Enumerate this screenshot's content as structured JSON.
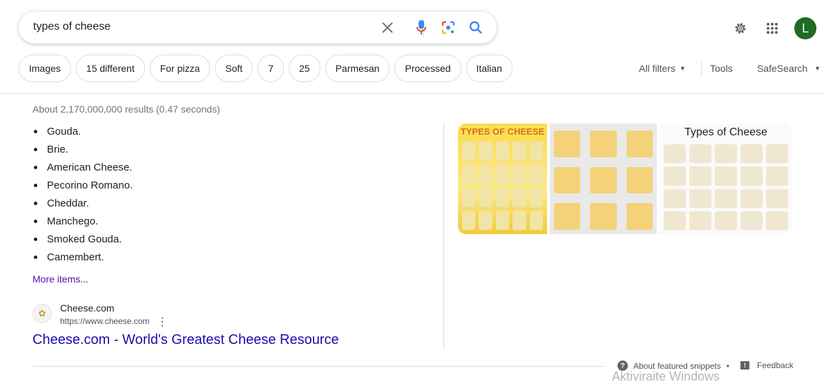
{
  "search": {
    "query": "types of cheese"
  },
  "chips": [
    "Images",
    "15 different",
    "For pizza",
    "Soft",
    "7",
    "25",
    "Parmesan",
    "Processed",
    "Italian"
  ],
  "tools": {
    "all_filters": "All filters",
    "tools": "Tools",
    "safesearch": "SafeSearch"
  },
  "account": {
    "initial": "L",
    "color": "#1e6b24"
  },
  "stats": "About 2,170,000,000 results (0.47 seconds)",
  "snippet": {
    "items": [
      "Gouda.",
      "Brie.",
      "American Cheese.",
      "Pecorino Romano.",
      "Cheddar.",
      "Manchego.",
      "Smoked Gouda.",
      "Camembert."
    ],
    "more": "More items..."
  },
  "result": {
    "site": "Cheese.com",
    "url": "https://www.cheese.com",
    "title": "Cheese.com - World's Greatest Cheese Resource"
  },
  "images": [
    {
      "caption": "TYPES OF CHEESE"
    },
    {
      "caption": ""
    },
    {
      "caption": "Types of Cheese"
    }
  ],
  "footer": {
    "about": "About featured snippets",
    "separator": "•",
    "feedback": "Feedback"
  },
  "watermark": "Aktiviraite Windows"
}
